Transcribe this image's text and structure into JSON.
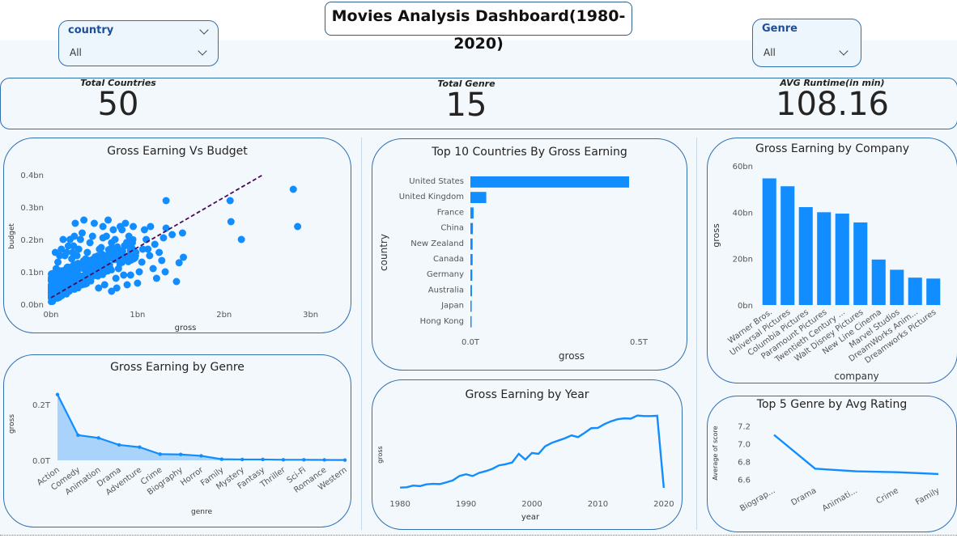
{
  "dashboard_title": "Movies Analysis Dashboard(1980-2020)",
  "slicers": {
    "country": {
      "label": "country",
      "value": "All"
    },
    "genre": {
      "label": "Genre",
      "value": "All"
    }
  },
  "kpis": {
    "total_countries": {
      "label": "Total Countries",
      "value": "50"
    },
    "total_genre": {
      "label": "Total Genre",
      "value": "15"
    },
    "avg_runtime": {
      "label": "AVG Runtime(in min)",
      "value": "108.16"
    }
  },
  "colors": {
    "accent": "#118DFF",
    "trend": "#4b0a5a",
    "border": "#2f6fb0",
    "background": "#f3f8fc"
  },
  "chart_data": [
    {
      "id": "scatter",
      "type": "scatter",
      "title": "Gross Earning Vs Budget",
      "xlabel": "gross",
      "ylabel": "budget",
      "xlim": [
        0,
        3.2
      ],
      "ylim": [
        0,
        0.42
      ],
      "x_ticks": [
        "0bn",
        "1bn",
        "2bn",
        "3bn"
      ],
      "y_ticks": [
        "0.0bn",
        "0.1bn",
        "0.2bn",
        "0.3bn",
        "0.4bn"
      ],
      "trendline": true,
      "trend_values": [
        [
          0,
          0.02
        ],
        [
          2.45,
          0.4
        ]
      ],
      "points": [
        [
          2.8,
          0.355
        ],
        [
          2.85,
          0.24
        ],
        [
          2.07,
          0.32
        ],
        [
          2.08,
          0.255
        ],
        [
          2.2,
          0.2
        ],
        [
          1.33,
          0.32
        ],
        [
          1.33,
          0.235
        ],
        [
          1.3,
          0.205
        ],
        [
          1.15,
          0.24
        ],
        [
          1.2,
          0.185
        ],
        [
          1.12,
          0.17
        ],
        [
          1.4,
          0.215
        ],
        [
          1.52,
          0.22
        ],
        [
          1.53,
          0.145
        ],
        [
          1.48,
          0.128
        ],
        [
          1.45,
          0.07
        ],
        [
          1.32,
          0.1
        ],
        [
          1.28,
          0.135
        ],
        [
          1.1,
          0.2
        ],
        [
          1.05,
          0.13
        ],
        [
          0.95,
          0.24
        ],
        [
          0.9,
          0.21
        ],
        [
          0.85,
          0.18
        ],
        [
          0.82,
          0.23
        ],
        [
          0.8,
          0.15
        ],
        [
          0.78,
          0.11
        ],
        [
          0.75,
          0.08
        ],
        [
          0.72,
          0.23
        ],
        [
          0.7,
          0.19
        ],
        [
          0.68,
          0.15
        ],
        [
          0.65,
          0.12
        ],
        [
          0.62,
          0.1
        ],
        [
          0.6,
          0.205
        ],
        [
          0.58,
          0.175
        ],
        [
          0.55,
          0.14
        ],
        [
          0.52,
          0.12
        ],
        [
          0.5,
          0.25
        ],
        [
          0.48,
          0.21
        ],
        [
          0.45,
          0.19
        ],
        [
          0.42,
          0.16
        ],
        [
          0.4,
          0.14
        ],
        [
          0.38,
          0.26
        ],
        [
          0.36,
          0.22
        ],
        [
          0.34,
          0.2
        ],
        [
          0.32,
          0.17
        ],
        [
          0.3,
          0.15
        ],
        [
          0.28,
          0.25
        ],
        [
          0.27,
          0.21
        ],
        [
          0.26,
          0.18
        ],
        [
          0.25,
          0.16
        ],
        [
          0.24,
          0.14
        ],
        [
          0.22,
          0.2
        ],
        [
          0.2,
          0.18
        ],
        [
          0.18,
          0.16
        ],
        [
          0.16,
          0.15
        ],
        [
          0.14,
          0.2
        ],
        [
          0.12,
          0.17
        ],
        [
          0.1,
          0.15
        ],
        [
          0.08,
          0.13
        ],
        [
          0.06,
          0.11
        ],
        [
          0.05,
          0.16
        ],
        [
          0.04,
          0.09
        ],
        [
          1.0,
          0.065
        ],
        [
          1.02,
          0.1
        ],
        [
          0.92,
          0.09
        ],
        [
          0.88,
          0.06
        ],
        [
          0.98,
          0.16
        ],
        [
          1.08,
          0.23
        ],
        [
          1.18,
          0.11
        ],
        [
          1.22,
          0.08
        ],
        [
          1.25,
          0.16
        ],
        [
          0.55,
          0.05
        ],
        [
          0.62,
          0.06
        ],
        [
          0.7,
          0.04
        ],
        [
          0.76,
          0.05
        ],
        [
          0.84,
          0.09
        ],
        [
          0.46,
          0.08
        ],
        [
          0.36,
          0.06
        ],
        [
          0.6,
          0.24
        ],
        [
          0.66,
          0.26
        ],
        [
          0.74,
          0.2
        ],
        [
          0.86,
          0.25
        ],
        [
          0.94,
          0.19
        ],
        [
          1.06,
          0.17
        ],
        [
          1.14,
          0.15
        ],
        [
          0.44,
          0.1
        ],
        [
          0.34,
          0.12
        ],
        [
          0.56,
          0.17
        ],
        [
          0.64,
          0.21
        ],
        [
          0.8,
          0.24
        ],
        [
          0.9,
          0.14
        ]
      ],
      "dense_cluster": true
    },
    {
      "id": "countries",
      "type": "bar",
      "orientation": "horizontal",
      "title": "Top 10 Countries By Gross Earning",
      "xlabel": "gross",
      "ylabel": "country",
      "x_ticks": [
        "0.0T",
        "0.5T"
      ],
      "xlim": [
        0,
        0.5
      ],
      "categories": [
        "United States",
        "United Kingdom",
        "France",
        "China",
        "New Zealand",
        "Canada",
        "Germany",
        "Australia",
        "Japan",
        "Hong Kong"
      ],
      "values": [
        0.5,
        0.05,
        0.01,
        0.008,
        0.007,
        0.007,
        0.006,
        0.005,
        0.004,
        0.003
      ]
    },
    {
      "id": "company",
      "type": "bar",
      "title": "Gross Earning by Company",
      "xlabel": "company",
      "ylabel": "gross",
      "ylim": [
        0,
        60
      ],
      "y_ticks": [
        "0bn",
        "20bn",
        "40bn",
        "60bn"
      ],
      "categories": [
        "Warner Bros.",
        "Universal Pictures",
        "Columbia Pictures",
        "Paramount Pictures",
        "Twentieth Century ...",
        "Walt Disney Pictures",
        "New Line Cinema",
        "Marvel Studios",
        "DreamWorks Anim...",
        "Dreamworks Pictures"
      ],
      "values": [
        54.6,
        51.2,
        42.2,
        40,
        39.4,
        35.6,
        19.6,
        15.2,
        11.8,
        11.4
      ]
    },
    {
      "id": "genre",
      "type": "area",
      "title": "Gross Earning by Genre",
      "xlabel": "genre",
      "ylabel": "gross",
      "ylim": [
        0,
        0.26
      ],
      "y_ticks": [
        "0.0T",
        "0.2T"
      ],
      "categories": [
        "Action",
        "Comedy",
        "Animation",
        "Drama",
        "Adventure",
        "Crime",
        "Biography",
        "Horror",
        "Family",
        "Mystery",
        "Fantasy",
        "Thriller",
        "Sci-Fi",
        "Romance",
        "Western"
      ],
      "values": [
        0.235,
        0.09,
        0.08,
        0.055,
        0.047,
        0.022,
        0.021,
        0.016,
        0.004,
        0.003,
        0.003,
        0.002,
        0.002,
        0.0015,
        0.001
      ]
    },
    {
      "id": "year",
      "type": "line",
      "title": "Gross Earning by Year",
      "xlabel": "year",
      "ylabel": "gross",
      "x_ticks": [
        "1980",
        "1990",
        "2000",
        "2010",
        "2020"
      ],
      "xlim": [
        1979,
        2021
      ],
      "ylim": [
        0,
        27.5
      ],
      "x": [
        1980,
        1981,
        1982,
        1983,
        1984,
        1985,
        1986,
        1987,
        1988,
        1989,
        1990,
        1991,
        1992,
        1993,
        1994,
        1995,
        1996,
        1997,
        1998,
        1999,
        2000,
        2001,
        2002,
        2003,
        2004,
        2005,
        2006,
        2007,
        2008,
        2009,
        2010,
        2011,
        2012,
        2013,
        2014,
        2015,
        2016,
        2017,
        2018,
        2019,
        2020
      ],
      "values": [
        1.5,
        1.6,
        2.2,
        2.0,
        2.6,
        2.8,
        2.7,
        3.3,
        4.0,
        5.5,
        6.1,
        5.5,
        6.6,
        7.2,
        8.0,
        9.2,
        9.6,
        10.2,
        13.2,
        11.2,
        13.5,
        13.2,
        15.8,
        17.0,
        17.8,
        18.6,
        19.6,
        19.0,
        20.5,
        22.1,
        22.2,
        23.5,
        24.5,
        25.2,
        25.5,
        25.4,
        26.5,
        26.3,
        26.3,
        26.4,
        1.4
      ]
    },
    {
      "id": "rating",
      "type": "line",
      "title": "Top 5 Genre by Avg Rating",
      "xlabel": "",
      "ylabel": "Average of score",
      "ylim": [
        6.55,
        7.25
      ],
      "y_ticks": [
        "6.6",
        "6.8",
        "7.0",
        "7.2"
      ],
      "categories": [
        "Biograp...",
        "Drama",
        "Animati...",
        "Crime",
        "Family"
      ],
      "values": [
        7.1,
        6.72,
        6.69,
        6.68,
        6.66
      ]
    }
  ]
}
